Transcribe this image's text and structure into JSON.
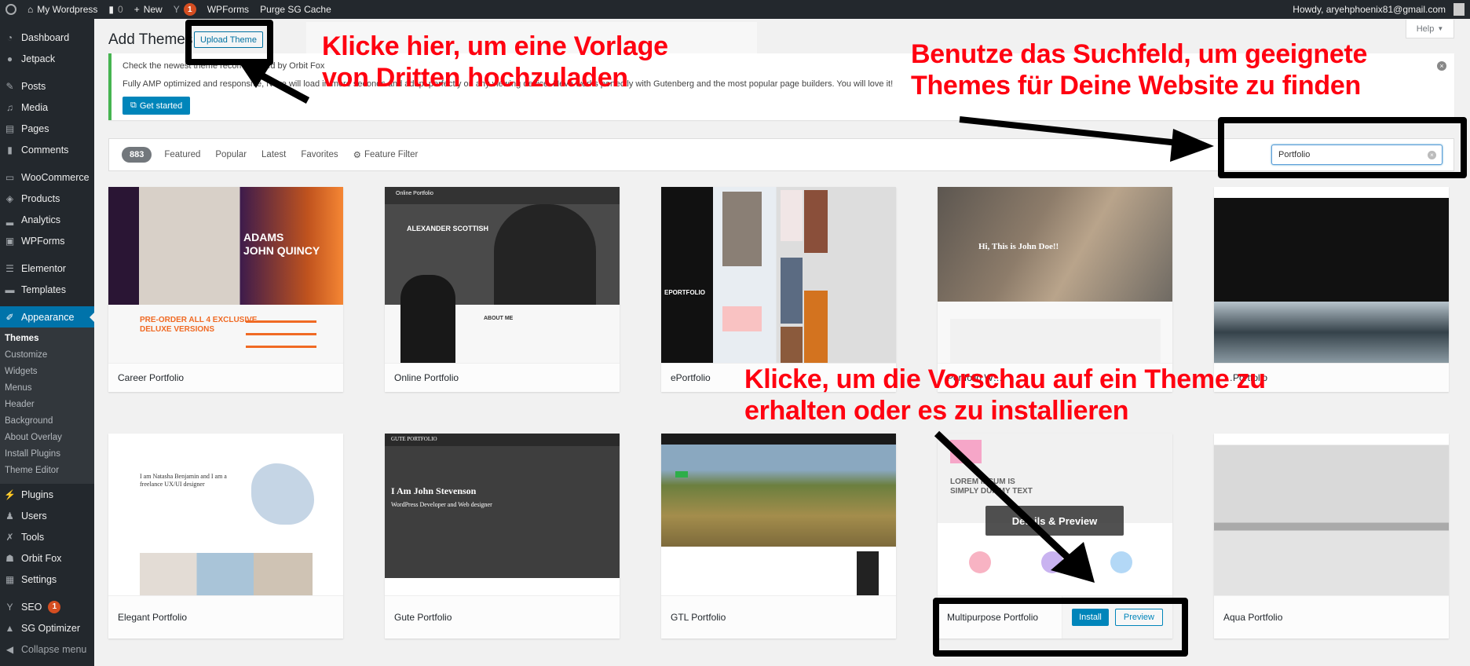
{
  "adminbar": {
    "site_name": "My Wordpress",
    "comments_count": "0",
    "new_label": "New",
    "yoast_badge": "1",
    "wpforms_label": "WPForms",
    "purge_label": "Purge SG Cache",
    "howdy": "Howdy, aryehphoenix81@gmail.com"
  },
  "sidebar": {
    "items": [
      {
        "label": "Dashboard",
        "icon": "dashboard-icon"
      },
      {
        "label": "Jetpack",
        "icon": "jetpack-icon"
      },
      {
        "label": "Posts",
        "icon": "pin-icon"
      },
      {
        "label": "Media",
        "icon": "media-icon"
      },
      {
        "label": "Pages",
        "icon": "pages-icon"
      },
      {
        "label": "Comments",
        "icon": "comment-icon"
      },
      {
        "label": "WooCommerce",
        "icon": "woocommerce-icon"
      },
      {
        "label": "Products",
        "icon": "box-icon"
      },
      {
        "label": "Analytics",
        "icon": "bar-chart-icon"
      },
      {
        "label": "WPForms",
        "icon": "form-icon"
      },
      {
        "label": "Elementor",
        "icon": "elementor-icon"
      },
      {
        "label": "Templates",
        "icon": "folder-icon"
      },
      {
        "label": "Appearance",
        "icon": "brush-icon"
      }
    ],
    "appearance_sub": [
      "Themes",
      "Customize",
      "Widgets",
      "Menus",
      "Header",
      "Background",
      "About Overlay",
      "Install Plugins",
      "Theme Editor"
    ],
    "items_after": [
      {
        "label": "Plugins",
        "icon": "plug-icon"
      },
      {
        "label": "Users",
        "icon": "user-icon"
      },
      {
        "label": "Tools",
        "icon": "wrench-icon"
      },
      {
        "label": "Orbit Fox",
        "icon": "fox-icon"
      },
      {
        "label": "Settings",
        "icon": "settings-icon"
      },
      {
        "label": "SEO",
        "icon": "yoast-icon",
        "badge": "1"
      },
      {
        "label": "SG Optimizer",
        "icon": "sg-icon"
      }
    ],
    "collapse_label": "Collapse menu"
  },
  "header": {
    "help_label": "Help",
    "page_title": "Add Themes",
    "upload_label": "Upload Theme"
  },
  "notice": {
    "line1": "Check the newest theme recommended by Orbit Fox",
    "line2": "Fully AMP optimized and responsive, Neve will load in mere seconds and adapt perfectly on any viewing device. Neve works perfectly with Gutenberg and the most popular page builders. You will love it!",
    "button": "Get started"
  },
  "filter": {
    "count": "883",
    "tabs": [
      "Featured",
      "Popular",
      "Latest",
      "Favorites"
    ],
    "feature_filter": "Feature Filter",
    "search_value": "Portfolio"
  },
  "themes": [
    {
      "name": "Career Portfolio"
    },
    {
      "name": "Online Portfolio"
    },
    {
      "name": "ePortfolio"
    },
    {
      "name": "Portfolio W…"
    },
    {
      "name": "…Portfolio"
    },
    {
      "name": "Elegant Portfolio"
    },
    {
      "name": "Gute Portfolio"
    },
    {
      "name": "GTL Portfolio"
    },
    {
      "name": "Multipurpose Portfolio",
      "install": "Install",
      "preview": "Preview",
      "overlay": "Details & Preview"
    },
    {
      "name": "Aqua Portfolio"
    }
  ],
  "screenshot_text": {
    "career_h1": "ADAMS\nJOHN QUINCY",
    "career_promo": "PRE-ORDER ALL 4 EXCLUSIVE\nDELUXE VERSIONS",
    "online_nav": "Online Portfolio",
    "online_name": "ALEXANDER SCOTTISH",
    "online_about": "ABOUT ME",
    "eport_title": "EPORTFOLIO",
    "pwp_hero": "Hi, This is John Doe!!",
    "elegant_text": "I am Natasha Benjamin and I am a freelance UX/UI designer",
    "gute_nav": "GUTE PORTFOLIO",
    "gute_h": "I Am John Stevenson",
    "gute_s": "WordPress Developer and Web designer",
    "multi_text": "LOREM IPSUM IS\nSIMPLY DUMMY TEXT"
  },
  "annotations": {
    "upload": "Klicke hier, um eine Vorlage\nvon Dritten hochzuladen",
    "search": "Benutze das Suchfeld, um geeignete\nThemes für Deine Website zu finden",
    "install": "Klicke, um die Vorschau auf ein Theme zu\nerhalten oder es zu installieren"
  },
  "colors": {
    "accent": "#0073aa",
    "annotation": "#ff0010",
    "notice_border": "#46b450"
  }
}
